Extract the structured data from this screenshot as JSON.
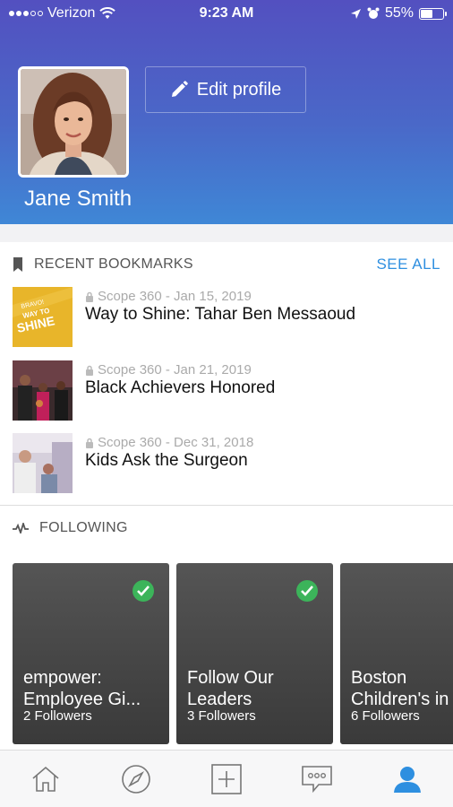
{
  "status_bar": {
    "carrier": "Verizon",
    "time": "9:23 AM",
    "battery": "55%",
    "battery_level": 0.55
  },
  "profile": {
    "name": "Jane Smith",
    "edit_label": "Edit profile"
  },
  "bookmarks": {
    "section_title": "RECENT BOOKMARKS",
    "see_all": "SEE ALL",
    "items": [
      {
        "meta": "Scope 360 - Jan 15, 2019",
        "title": "Way to Shine: Tahar Ben Messaoud",
        "thumb_text": [
          "BRAVO!",
          "WAY TO",
          "SHINE"
        ]
      },
      {
        "meta": "Scope 360 - Jan 21, 2019",
        "title": "Black Achievers Honored"
      },
      {
        "meta": "Scope 360 - Dec 31, 2018",
        "title": "Kids Ask the Surgeon"
      }
    ]
  },
  "following": {
    "section_title": "FOLLOWING",
    "tiles": [
      {
        "name_line1": "empower:",
        "name_line2": "Employee Gi...",
        "followers": "2 Followers",
        "followed": true
      },
      {
        "name_line1": "Follow Our",
        "name_line2": "Leaders",
        "followers": "3 Followers",
        "followed": true
      },
      {
        "name_line1": "Boston",
        "name_line2": "Children's in",
        "followers": "6 Followers",
        "followed": false
      }
    ]
  },
  "tabbar": {
    "tabs": [
      {
        "icon": "home-icon",
        "active": false
      },
      {
        "icon": "compass-icon",
        "active": false
      },
      {
        "icon": "plus-icon",
        "active": false
      },
      {
        "icon": "chat-icon",
        "active": false
      },
      {
        "icon": "profile-icon",
        "active": true
      }
    ]
  },
  "colors": {
    "header_top": "#5350c0",
    "header_bottom": "#3f87d6",
    "accent": "#2e8fe0",
    "check": "#3cb45a",
    "thumb_yellow": "#e8b52a"
  }
}
